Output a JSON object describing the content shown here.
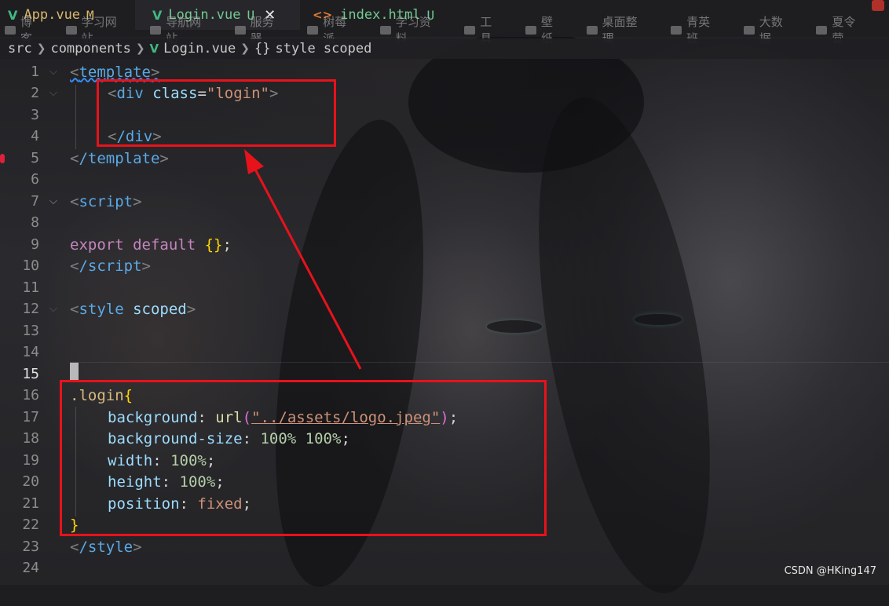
{
  "tabs": [
    {
      "icon": "vue-icon",
      "name": "App.vue",
      "badge": "M",
      "state": "modified"
    },
    {
      "icon": "vue-icon",
      "name": "Login.vue",
      "badge": "U",
      "state": "untracked",
      "active": true
    },
    {
      "icon": "html-icon",
      "name": "index.html",
      "badge": "U",
      "state": "untracked"
    }
  ],
  "bookmarks": [
    "博客",
    "学习网站",
    "导航网站",
    "服务器",
    "树莓派",
    "学习资料",
    "工具",
    "壁纸",
    "桌面整理",
    "青英班",
    "大数据",
    "夏令营"
  ],
  "breadcrumb": {
    "folder": "src",
    "subfolder": "components",
    "file": "Login.vue",
    "braces": "{}",
    "symbol": "style scoped"
  },
  "line_numbers": [
    "1",
    "2",
    "3",
    "4",
    "5",
    "6",
    "7",
    "8",
    "9",
    "10",
    "11",
    "12",
    "13",
    "14",
    "15",
    "16",
    "17",
    "18",
    "19",
    "20",
    "21",
    "22",
    "23",
    "24"
  ],
  "code": {
    "l1_tag": "template",
    "l2_tag": "div",
    "l2_attr": "class",
    "l2_eq": "=",
    "l2_value": "\"login\"",
    "l4_tag": "/div",
    "l5_tag": "/template",
    "l7_tag": "script",
    "l9_kw": "export default",
    "l9_obj": "{}",
    "l9_end": ";",
    "l10_tag": "/script",
    "l12_tag": "style",
    "l12_attr": "scoped",
    "l16_selector": ".login",
    "l16_brace": "{",
    "l17_prop": "background",
    "l17_fn": "url",
    "l17_arg": "\"../assets/logo.jpeg\"",
    "l18_prop": "background-size",
    "l18_value": "100% 100%",
    "l19_prop": "width",
    "l19_value": "100%",
    "l20_prop": "height",
    "l20_value": "100%",
    "l21_prop": "position",
    "l21_value": "fixed",
    "l22_brace": "}",
    "l23_tag": "/style"
  },
  "watermark": "CSDN @HKing147",
  "colors": {
    "annotation": "#e8121b",
    "vue": "#41b883"
  }
}
